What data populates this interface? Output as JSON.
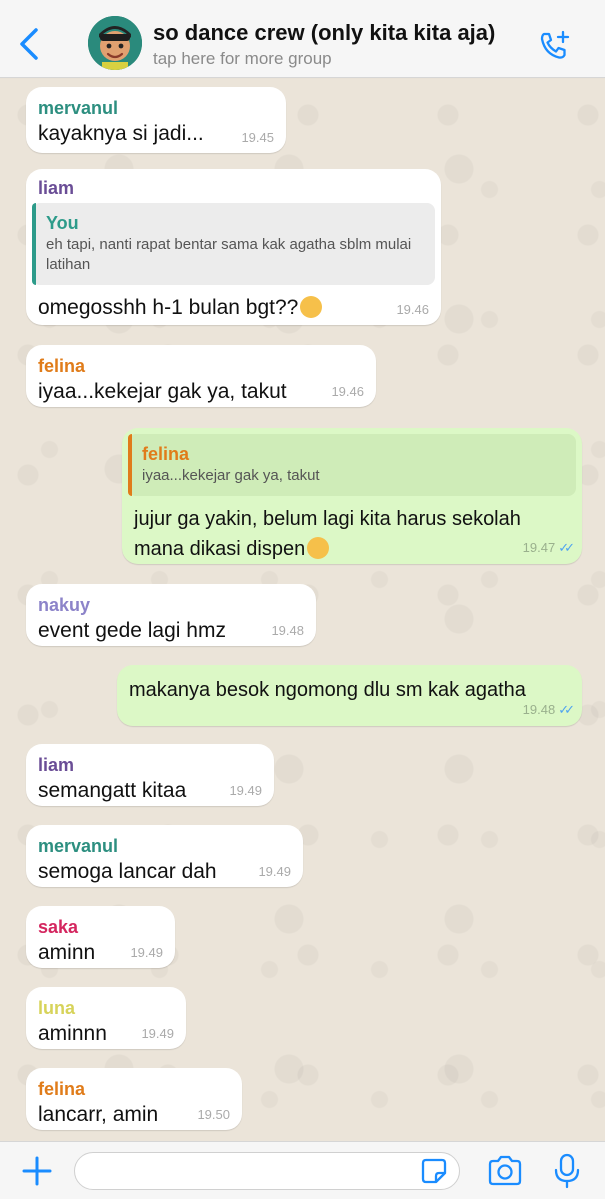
{
  "header": {
    "title": "so dance crew (only kita kita aja)",
    "subtitle": "tap here for more group"
  },
  "colors": {
    "accent": "#1a8cff",
    "outgoing_bubble": "#dcf8c6",
    "incoming_bubble": "#ffffff",
    "read_ticks": "#4fa3f0"
  },
  "messages": [
    {
      "sender": "mervanul",
      "sender_color": "#2d8f80",
      "text": "kayaknya si jadi...",
      "time": "19.45"
    },
    {
      "sender": "liam",
      "sender_color": "#6a4d96",
      "quote_name": "You",
      "quote_color": "#2d9b8a",
      "quote_text": "eh tapi, nanti rapat bentar sama kak agatha sblm mulai latihan",
      "text": "omegosshh h-1 bulan bgt??",
      "emoji": "tired-face-emoji",
      "time": "19.46"
    },
    {
      "sender": "felina",
      "sender_color": "#e07c1a",
      "text": "iyaa...kekejar gak ya, takut",
      "time": "19.46"
    },
    {
      "direction": "out",
      "quote_name": "felina",
      "quote_color": "#e07c1a",
      "quote_text": "iyaa...kekejar gak ya, takut",
      "text": "jujur ga yakin, belum lagi kita harus sekolah mana dikasi dispen",
      "emoji": "slightly-smiling-face-emoji",
      "time": "19.47",
      "status_icon": "double-check-icon"
    },
    {
      "sender": "nakuy",
      "sender_color": "#8c83c9",
      "text": "event gede lagi hmz",
      "time": "19.48"
    },
    {
      "direction": "out",
      "text": "makanya besok ngomong dlu sm kak agatha",
      "time": "19.48",
      "status_icon": "double-check-icon"
    },
    {
      "sender": "liam",
      "sender_color": "#6a4d96",
      "text": "semangatt kitaa",
      "time": "19.49"
    },
    {
      "sender": "mervanul",
      "sender_color": "#2d8f80",
      "text": "semoga lancar dah",
      "time": "19.49"
    },
    {
      "sender": "saka",
      "sender_color": "#d4265f",
      "text": "aminn",
      "time": "19.49"
    },
    {
      "sender": "luna",
      "sender_color": "#d7d35a",
      "text": "aminnn",
      "time": "19.49"
    },
    {
      "sender": "felina",
      "sender_color": "#e07c1a",
      "text": "lancarr, amin",
      "time": "19.50"
    }
  ],
  "composer": {
    "value": "",
    "placeholder": ""
  }
}
